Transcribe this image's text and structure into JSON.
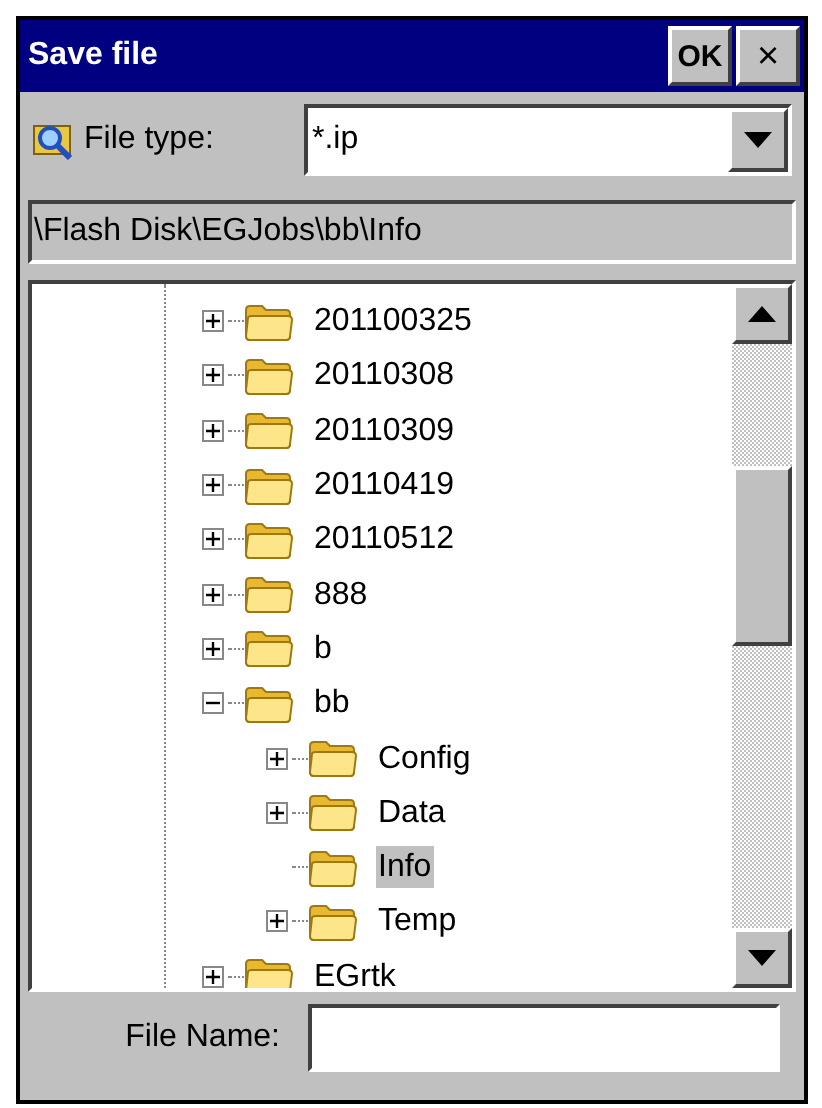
{
  "window": {
    "title": "Save file",
    "buttons": [
      "OK",
      "×"
    ]
  },
  "file_type": {
    "label": "File type:",
    "value": "*.ip"
  },
  "path": "\\Flash Disk\\EGJobs\\bb\\Info",
  "tree": [
    {
      "label": "201100325",
      "expandable": true,
      "expanded": false,
      "selected": false
    },
    {
      "label": "20110308",
      "expandable": true,
      "expanded": false,
      "selected": false
    },
    {
      "label": "20110309",
      "expandable": true,
      "expanded": false,
      "selected": false
    },
    {
      "label": "20110419",
      "expandable": true,
      "expanded": false,
      "selected": false
    },
    {
      "label": "20110512",
      "expandable": true,
      "expanded": false,
      "selected": false
    },
    {
      "label": "888",
      "expandable": true,
      "expanded": false,
      "selected": false
    },
    {
      "label": "b",
      "expandable": true,
      "expanded": false,
      "selected": false
    },
    {
      "label": "bb",
      "expandable": true,
      "expanded": true,
      "selected": false,
      "children": [
        {
          "label": "Config",
          "expandable": true,
          "selected": false
        },
        {
          "label": "Data",
          "expandable": true,
          "selected": false
        },
        {
          "label": "Info",
          "expandable": false,
          "selected": true
        },
        {
          "label": "Temp",
          "expandable": true,
          "selected": false
        }
      ]
    },
    {
      "label": "EGrtk",
      "expandable": true,
      "expanded": false,
      "selected": false
    }
  ],
  "file_name": {
    "label": "File Name:"
  }
}
